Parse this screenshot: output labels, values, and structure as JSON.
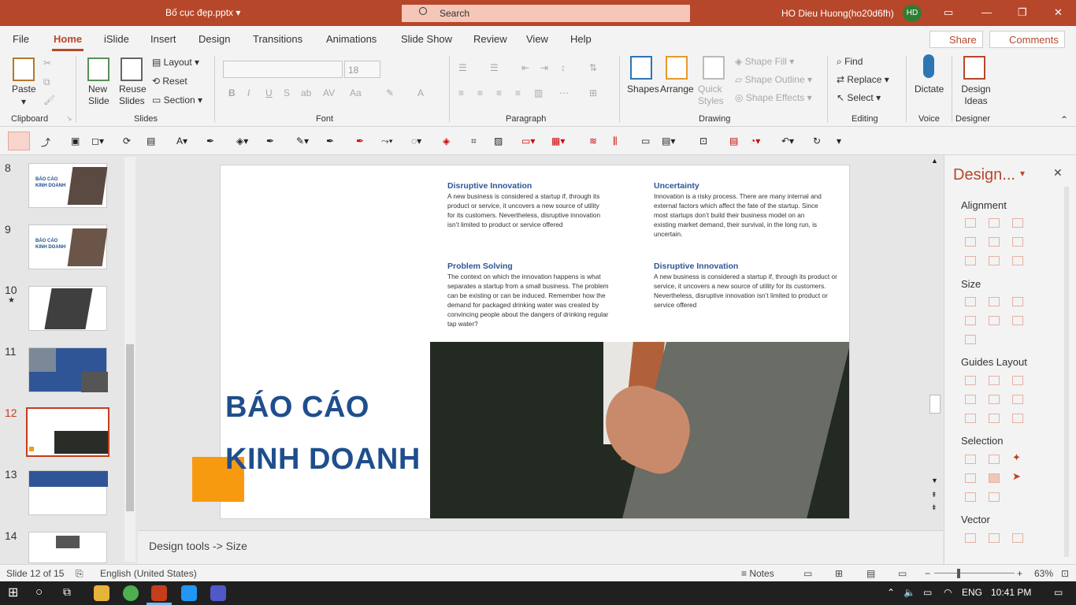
{
  "titlebar": {
    "filename": "Bố cục đẹp.pptx",
    "search_placeholder": "Search",
    "user": "HO Dieu Huong(ho20d6fh)",
    "avatar_initials": "HD"
  },
  "menu": {
    "tabs": [
      "File",
      "Home",
      "iSlide",
      "Insert",
      "Design",
      "Transitions",
      "Animations",
      "Slide Show",
      "Review",
      "View",
      "Help"
    ],
    "active": "Home",
    "share": "Share",
    "comments": "Comments"
  },
  "ribbon": {
    "clipboard": {
      "label": "Clipboard",
      "paste": "Paste"
    },
    "slides": {
      "label": "Slides",
      "new_slide": "New Slide",
      "reuse_slides": "Reuse Slides",
      "layout": "Layout",
      "reset": "Reset",
      "section": "Section"
    },
    "font": {
      "label": "Font",
      "size": "18"
    },
    "paragraph": {
      "label": "Paragraph"
    },
    "drawing": {
      "label": "Drawing",
      "shapes": "Shapes",
      "arrange": "Arrange",
      "quick_styles": "Quick Styles",
      "shape_fill": "Shape Fill",
      "shape_outline": "Shape Outline",
      "shape_effects": "Shape Effects"
    },
    "editing": {
      "label": "Editing",
      "find": "Find",
      "replace": "Replace",
      "select": "Select"
    },
    "voice": {
      "label": "Voice",
      "dictate": "Dictate"
    },
    "designer": {
      "label": "Designer",
      "design_ideas": "Design Ideas"
    }
  },
  "thumbnails": {
    "items": [
      {
        "num": "8",
        "title": "BÁO CÁO KINH DOANH"
      },
      {
        "num": "9",
        "title": "BÁO CÁO KINH DOANH"
      },
      {
        "num": "10",
        "star": "★"
      },
      {
        "num": "11"
      },
      {
        "num": "12",
        "active": true
      },
      {
        "num": "13"
      },
      {
        "num": "14"
      }
    ]
  },
  "slide": {
    "blocks": [
      {
        "heading": "Disruptive Innovation",
        "body": "A new business is considered a startup if, through its product or service, it uncovers a new source of utility for its customers. Nevertheless, disruptive innovation isn’t limited to product or service offered"
      },
      {
        "heading": "Uncertainty",
        "body": "Innovation is a risky process. There are many internal and external factors which affect the fate of the startup. Since most startups don’t build their business model on an existing market demand, their survival, in the long run, is uncertain."
      },
      {
        "heading": "Problem Solving",
        "body": "The context on which the innovation happens is what separates a startup from a small business. The problem can be existing or can be induced. Remember how the demand for packaged drinking water was created by convincing people about the dangers of drinking regular tap water?"
      },
      {
        "heading": "Disruptive Innovation",
        "body": "A new business is considered a startup if, through its product or service, it uncovers a new source of utility for its customers. Nevertheless, disruptive innovation isn’t limited to product or service offered"
      }
    ],
    "title_line1": "BÁO CÁO",
    "title_line2": "KINH DOANH"
  },
  "notes": "Design tools -> Size",
  "design_pane": {
    "title": "Design...",
    "sections": [
      "Alignment",
      "Size",
      "Guides Layout",
      "Selection",
      "Vector"
    ]
  },
  "status": {
    "slide": "Slide 12 of 15",
    "language": "English (United States)",
    "notes": "Notes",
    "zoom": "63%"
  },
  "taskbar": {
    "lang": "ENG",
    "time": "10:41 PM"
  },
  "colors": {
    "accent": "#b7472a",
    "title_blue": "#1f4e8c",
    "orange": "#f89a10"
  }
}
